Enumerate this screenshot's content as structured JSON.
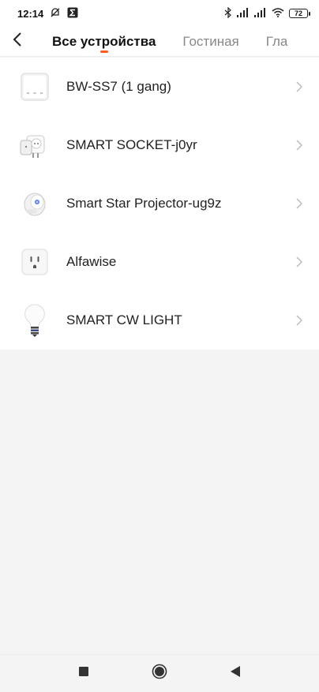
{
  "status_bar": {
    "time": "12:14",
    "battery": "72",
    "icons": [
      "alarm-off-icon",
      "sigma-icon",
      "bluetooth-icon",
      "signal-icon",
      "signal-icon",
      "wifi-icon",
      "battery-icon"
    ]
  },
  "header": {
    "back_icon": "chevron-left-icon",
    "tabs": [
      {
        "label": "Все устройства",
        "active": true
      },
      {
        "label": "Гостиная",
        "active": false
      },
      {
        "label": "Гла",
        "active": false
      }
    ],
    "accent_color": "#ff5a1f"
  },
  "devices": [
    {
      "name": "BW-SS7 (1 gang)",
      "icon": "wall-switch-icon"
    },
    {
      "name": "SMART SOCKET-j0yr",
      "icon": "smart-plug-icon"
    },
    {
      "name": "Smart Star Projector-ug9z",
      "icon": "projector-icon"
    },
    {
      "name": "Alfawise",
      "icon": "outlet-icon"
    },
    {
      "name": "SMART CW LIGHT",
      "icon": "light-bulb-icon"
    }
  ],
  "nav_bar": {
    "buttons": [
      "recents-square-icon",
      "home-circle-icon",
      "back-triangle-icon"
    ]
  }
}
